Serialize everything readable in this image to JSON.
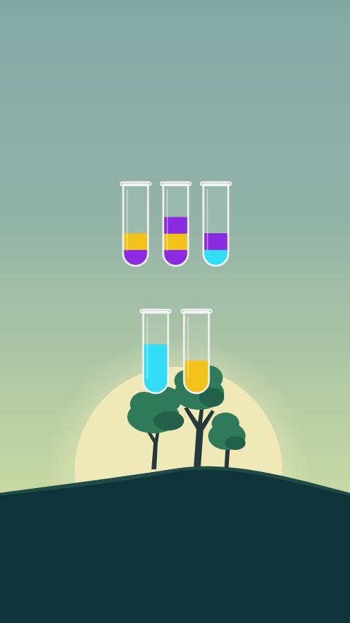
{
  "game": {
    "title": "",
    "colors": {
      "yellow": "#f2c21a",
      "purple": "#8a2be2",
      "cyan": "#33ddf6",
      "sky_top": "#86a8a4",
      "sky_bottom": "#c9d9a4",
      "sun": "#eee9b6",
      "hill_front": "#10333a",
      "hill_back": "#1f4a45",
      "tree_leaf": "#2f7a5a",
      "tree_leaf_dark": "#22604a",
      "tree_trunk": "#25393a",
      "glass": "#f3f6f4"
    },
    "tubes": [
      {
        "id": "tube-1",
        "capacity": 4,
        "layers": [
          "purple",
          "yellow"
        ]
      },
      {
        "id": "tube-2",
        "capacity": 4,
        "layers": [
          "purple",
          "yellow",
          "purple"
        ]
      },
      {
        "id": "tube-3",
        "capacity": 4,
        "layers": [
          "cyan",
          "purple"
        ]
      },
      {
        "id": "tube-4",
        "capacity": 4,
        "layers": [
          "cyan",
          "cyan",
          "cyan"
        ]
      },
      {
        "id": "tube-5",
        "capacity": 4,
        "layers": [
          "yellow",
          "yellow"
        ]
      }
    ]
  }
}
